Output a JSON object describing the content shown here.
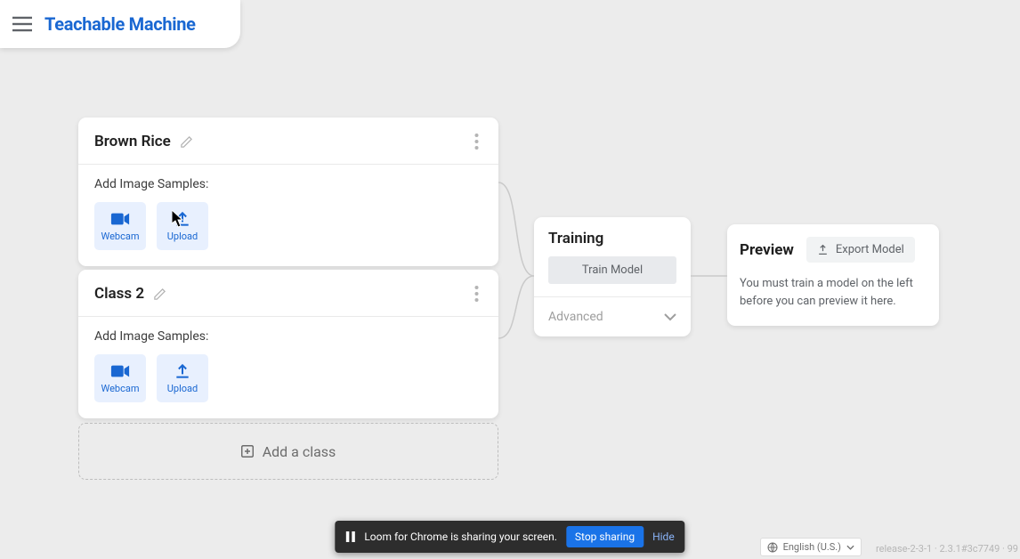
{
  "brand": "Teachable Machine",
  "classes": [
    {
      "title": "Brown Rice",
      "add_label": "Add Image Samples:",
      "webcam_label": "Webcam",
      "upload_label": "Upload"
    },
    {
      "title": "Class 2",
      "add_label": "Add Image Samples:",
      "webcam_label": "Webcam",
      "upload_label": "Upload"
    }
  ],
  "add_class_label": "Add a class",
  "training": {
    "title": "Training",
    "train_button": "Train Model",
    "advanced_label": "Advanced"
  },
  "preview": {
    "title": "Preview",
    "export_label": "Export Model",
    "help_text": "You must train a model on the left before you can preview it here."
  },
  "share": {
    "message": "Loom for Chrome is sharing your screen.",
    "stop_label": "Stop sharing",
    "hide_label": "Hide"
  },
  "language": "English (U.S.)",
  "release": "release-2-3-1 · 2.3.1#3c7749 · 99"
}
